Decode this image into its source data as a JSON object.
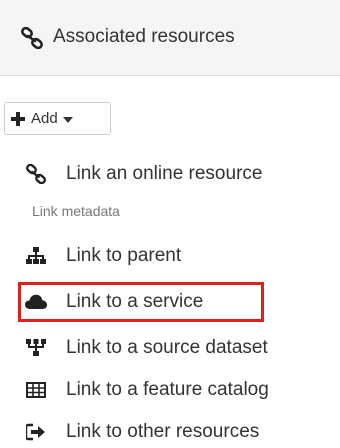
{
  "panel": {
    "title": "Associated resources",
    "title_icon": "link-icon"
  },
  "add_button": {
    "label": "Add",
    "icon": "plus-icon",
    "dropdown_icon": "caret-down-icon"
  },
  "menu": {
    "items": [
      {
        "label": "Link an online resource",
        "icon": "link-icon"
      },
      {
        "label": "Link to parent",
        "icon": "sitemap-icon"
      },
      {
        "label": "Link to a service",
        "icon": "cloud-icon",
        "highlighted": true
      },
      {
        "label": "Link to a source dataset",
        "icon": "source-tree-icon"
      },
      {
        "label": "Link to a feature catalog",
        "icon": "table-icon"
      },
      {
        "label": "Link to other resources",
        "icon": "share-icon"
      }
    ],
    "section_header": "Link metadata"
  },
  "colors": {
    "highlight_border": "#e0201f",
    "header_background": "#f5f5f5",
    "muted_text": "#777777"
  }
}
